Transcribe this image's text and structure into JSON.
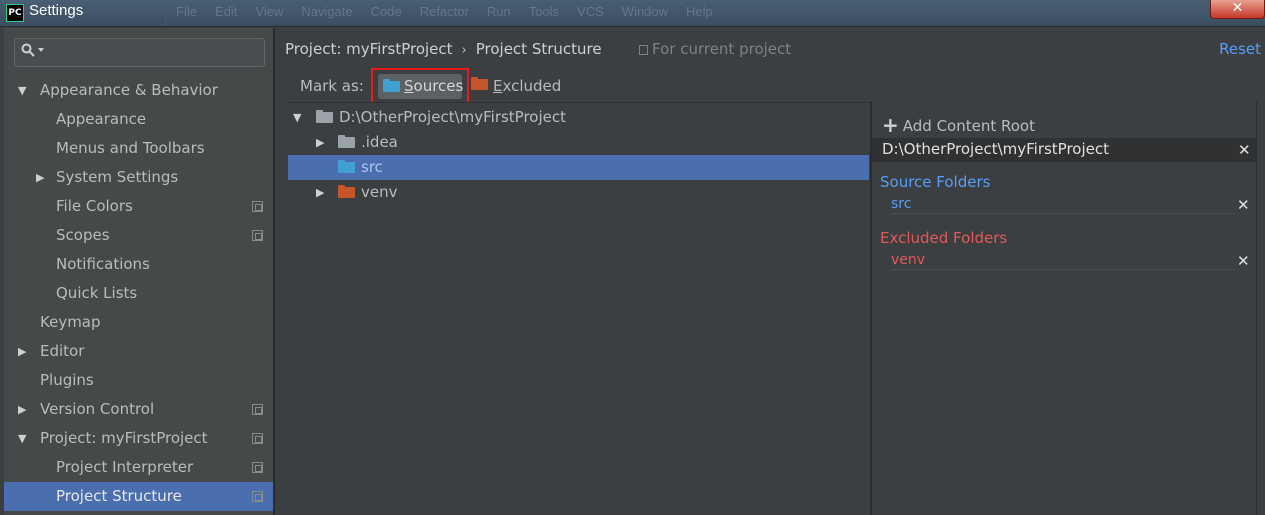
{
  "window": {
    "logo_text": "PC",
    "title": "Settings",
    "menu_ghost": [
      "File",
      "Edit",
      "View",
      "Navigate",
      "Code",
      "Refactor",
      "Run",
      "Tools",
      "VCS",
      "Window",
      "Help"
    ],
    "close_label": "✕"
  },
  "sidebar": {
    "search": {
      "value": "",
      "placeholder": ""
    },
    "items": [
      {
        "label": "Appearance & Behavior",
        "level": 0,
        "expanded": true
      },
      {
        "label": "Appearance",
        "level": 1
      },
      {
        "label": "Menus and Toolbars",
        "level": 1
      },
      {
        "label": "System Settings",
        "level": 1,
        "expanded": false
      },
      {
        "label": "File Colors",
        "level": 1,
        "project_icon": true
      },
      {
        "label": "Scopes",
        "level": 1,
        "project_icon": true
      },
      {
        "label": "Notifications",
        "level": 1
      },
      {
        "label": "Quick Lists",
        "level": 1
      },
      {
        "label": "Keymap",
        "level": 0
      },
      {
        "label": "Editor",
        "level": 0,
        "expanded": false
      },
      {
        "label": "Plugins",
        "level": 0
      },
      {
        "label": "Version Control",
        "level": 0,
        "expanded": false,
        "project_icon": true
      },
      {
        "label": "Project: myFirstProject",
        "level": 0,
        "expanded": true,
        "project_icon": true
      },
      {
        "label": "Project Interpreter",
        "level": 1,
        "project_icon": true
      },
      {
        "label": "Project Structure",
        "level": 1,
        "project_icon": true,
        "selected": true
      }
    ]
  },
  "header": {
    "breadcrumb": [
      "Project: myFirstProject",
      "Project Structure"
    ],
    "breadcrumb_sep": "›",
    "scope_note": "For current project",
    "reset_label": "Reset"
  },
  "mark_as": {
    "label": "Mark as:",
    "sources_label": "Sources",
    "excluded_label": "Excluded"
  },
  "file_tree": [
    {
      "label": "D:\\OtherProject\\myFirstProject",
      "color": "grey",
      "expanded": true
    },
    {
      "label": ".idea",
      "color": "grey",
      "expanded": false
    },
    {
      "label": "src",
      "color": "blue",
      "selected": true
    },
    {
      "label": "venv",
      "color": "orange",
      "expanded": false
    }
  ],
  "content_root": {
    "add_label": "Add Content Root",
    "path": "D:\\OtherProject\\myFirstProject",
    "source_folders_title": "Source Folders",
    "source_folders": [
      "src"
    ],
    "excluded_folders_title": "Excluded Folders",
    "excluded_folders": [
      "venv"
    ]
  },
  "colors": {
    "accent_blue": "#589df6",
    "excluded_red": "#e2585a",
    "selection": "#4b6eaf",
    "highlight_box": "#e81b1b"
  }
}
